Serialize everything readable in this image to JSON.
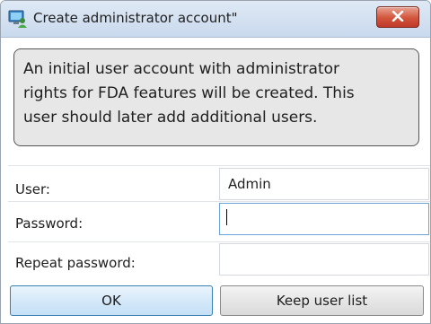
{
  "window": {
    "title": "Create administrator account\"",
    "close_icon": "close-x-icon",
    "app_icon": "computer-user-icon"
  },
  "info": {
    "lines": [
      "An initial user account with administrator",
      "rights for FDA features will be created. This",
      "user should later add additional users."
    ]
  },
  "form": {
    "user_label": "User:",
    "user_value": "Admin",
    "password_label": "Password:",
    "password_value": "",
    "repeat_label": "Repeat password:",
    "repeat_value": ""
  },
  "buttons": {
    "ok_label": "OK",
    "keep_label": "Keep user list"
  },
  "colors": {
    "close_button": "#d2543b",
    "ok_border": "#3c7fb1",
    "focus_border": "#6ea4d9"
  }
}
